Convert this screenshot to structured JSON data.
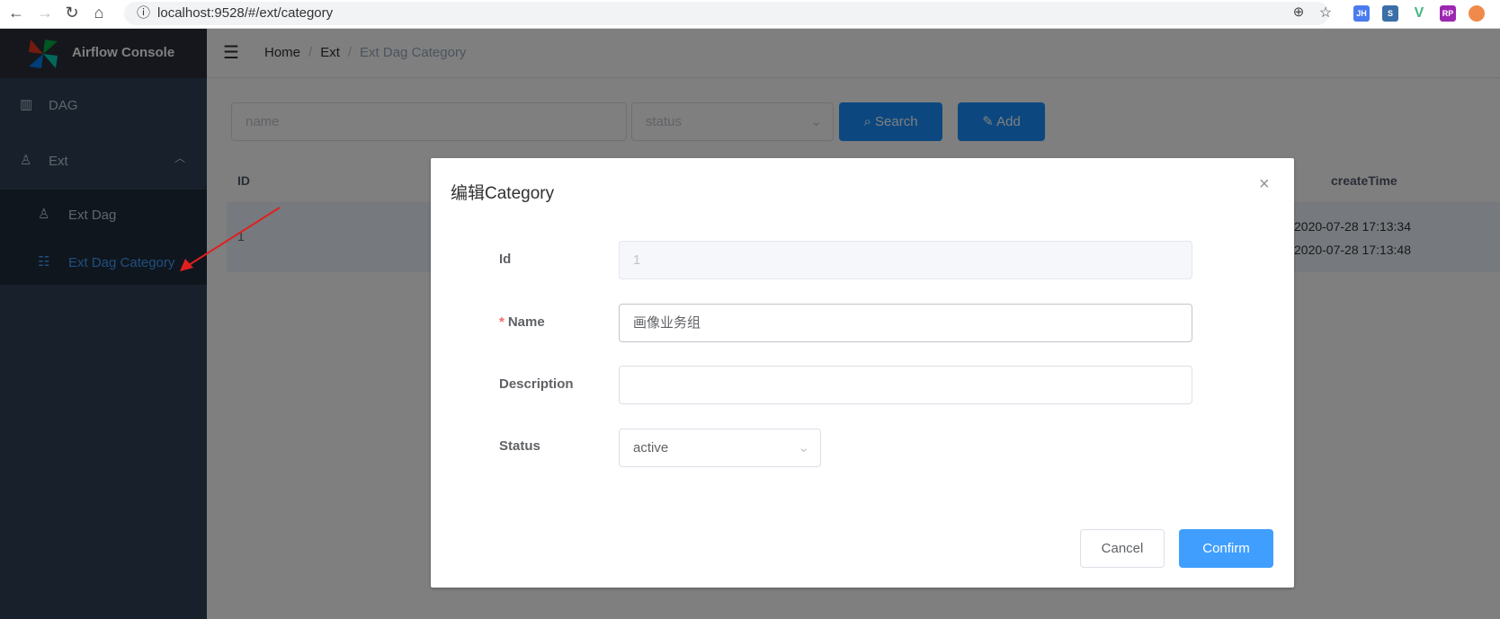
{
  "browser": {
    "url": "localhost:9528/#/ext/category",
    "extensions": [
      "JH",
      "S",
      "V",
      "RP"
    ]
  },
  "app": {
    "title": "Airflow Console"
  },
  "sidebar": {
    "items": [
      {
        "label": "DAG",
        "icon": "table-icon"
      },
      {
        "label": "Ext",
        "icon": "tree-icon",
        "expanded": true,
        "children": [
          {
            "label": "Ext Dag",
            "icon": "tree-icon"
          },
          {
            "label": "Ext Dag Category",
            "icon": "list-icon",
            "active": true
          }
        ]
      }
    ]
  },
  "breadcrumb": [
    "Home",
    "Ext",
    "Ext Dag Category"
  ],
  "filters": {
    "name_placeholder": "name",
    "status_placeholder": "status",
    "search_label": "Search",
    "add_label": "Add"
  },
  "table": {
    "headers": {
      "id": "ID",
      "createTime": "createTime"
    },
    "rows": [
      {
        "id": "1",
        "createTime": "2020-07-28 17:13:34",
        "updateTime": "2020-07-28 17:13:48"
      }
    ]
  },
  "modal": {
    "title": "编辑Category",
    "fields": {
      "id_label": "Id",
      "id_value": "1",
      "name_label": "Name",
      "name_value": "画像业务组",
      "description_label": "Description",
      "description_value": "",
      "status_label": "Status",
      "status_value": "active"
    },
    "cancel_label": "Cancel",
    "confirm_label": "Confirm"
  },
  "colors": {
    "primary": "#1890ff",
    "sidebar": "#304156",
    "active_menu": "#409eff",
    "required": "#f56c6c",
    "annotation_arrow": "#e02020"
  }
}
